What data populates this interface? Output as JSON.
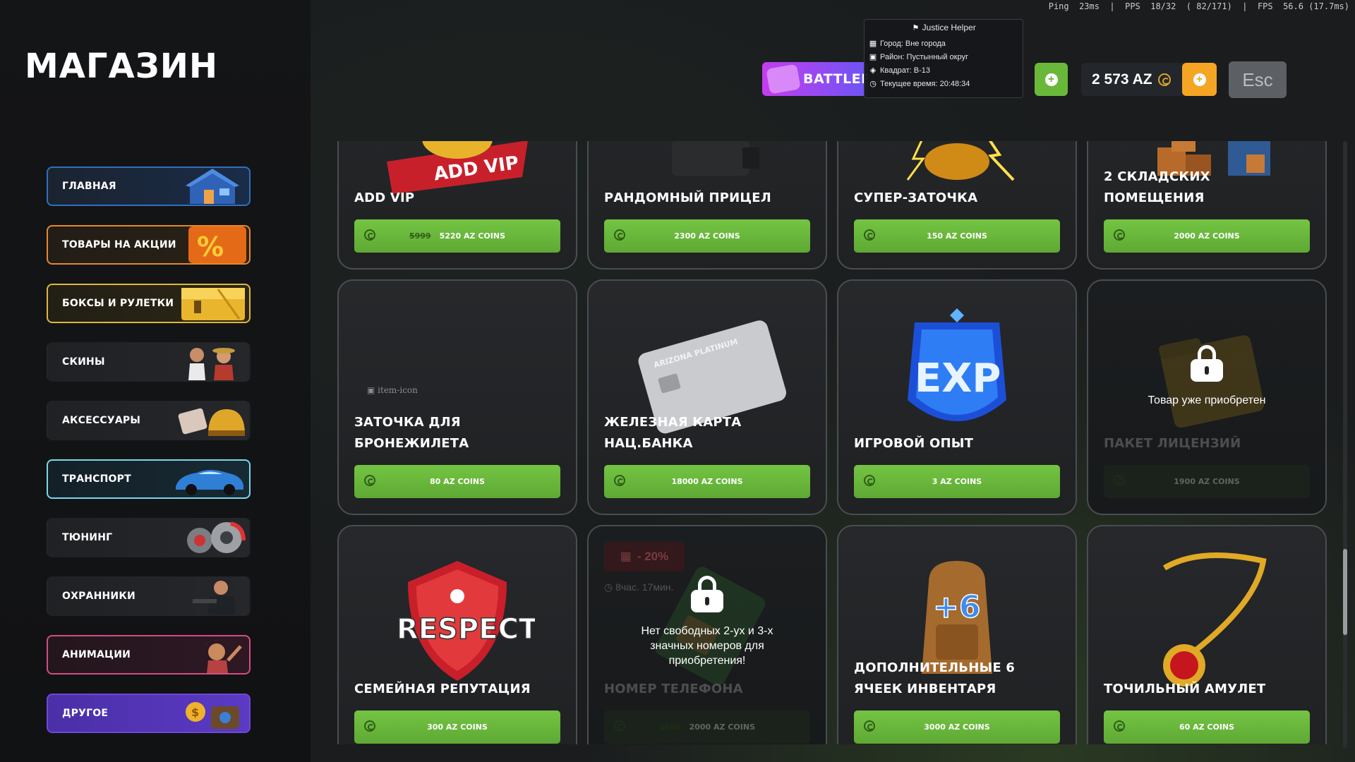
{
  "title": "МАГАЗИН",
  "perf": "Ping  23ms  |  PPS  18/32  ( 82/171)  |  FPS  56.6 (17.7ms)",
  "sidebar": {
    "items": [
      {
        "label": "ГЛАВНАЯ",
        "icon": "house-icon",
        "style": "blue"
      },
      {
        "label": "ТОВАРЫ НА АКЦИИ",
        "icon": "percent-icon",
        "style": "orange"
      },
      {
        "label": "БОКСЫ И РУЛЕТКИ",
        "icon": "chest-icon",
        "style": "yellow"
      },
      {
        "label": "СКИНЫ",
        "icon": "characters-icon",
        "style": ""
      },
      {
        "label": "АКСЕССУАРЫ",
        "icon": "helmet-icon",
        "style": ""
      },
      {
        "label": "ТРАНСПОРТ",
        "icon": "car-icon",
        "style": "cyan"
      },
      {
        "label": "ТЮНИНГ",
        "icon": "wheel-icon",
        "style": ""
      },
      {
        "label": "ОХРАННИКИ",
        "icon": "guard-icon",
        "style": ""
      },
      {
        "label": "АНИМАЦИИ",
        "icon": "dancer-icon",
        "style": "pink"
      },
      {
        "label": "ДРУГОЕ",
        "icon": "coins-bag-icon",
        "style": "purple"
      }
    ]
  },
  "topbar": {
    "battlepass": "BATTLEP",
    "balance": "2 573 AZ",
    "esc": "Esc"
  },
  "helper": {
    "title": "Justice Helper",
    "city": "Город: Вне города",
    "district": "Район: Пустынный округ",
    "square": "Квадрат: B-13",
    "time": "Текущее время: 20:48:34"
  },
  "products": [
    {
      "title": "ADD VIP",
      "price": "5220 AZ COINS",
      "old_price": "5999",
      "art": "vip-ribbon-icon"
    },
    {
      "title": "РАНДОМНЫЙ ПРИЦЕЛ",
      "price": "2300 AZ COINS",
      "art": "scope-icon"
    },
    {
      "title": "СУПЕР-ЗАТОЧКА",
      "price": "150 AZ COINS",
      "art": "lightning-icon"
    },
    {
      "title": "2 СКЛАДСКИХ ПОМЕЩЕНИЯ",
      "price": "2000 AZ COINS",
      "art": "warehouse-icon"
    },
    {
      "title": "ЗАТОЧКА ДЛЯ БРОНЕЖИЛЕТА",
      "price": "80 AZ COINS",
      "art": "broken-image-icon",
      "broken_alt": "item-icon"
    },
    {
      "title": "ЖЕЛЕЗНАЯ КАРТА НАЦ.БАНКА",
      "price": "18000 AZ COINS",
      "art": "bank-card-icon",
      "card_text": "ARIZONA PLATINUM"
    },
    {
      "title": "ИГРОВОЙ ОПЫТ",
      "price": "3 AZ COINS",
      "art": "exp-badge-icon",
      "badge_text": "EXP"
    },
    {
      "title": "ПАКЕТ ЛИЦЕНЗИЙ",
      "price": "1900 AZ COINS",
      "art": "license-folder-icon",
      "locked": true,
      "lock_text": "Товар уже приобретен"
    },
    {
      "title": "СЕМЕЙНАЯ РЕПУТАЦИЯ",
      "price": "300 AZ COINS",
      "art": "respect-shield-icon",
      "badge_text": "RESPECT"
    },
    {
      "title": "НОМЕР ТЕЛЕФОНА",
      "price": "2000 AZ COINS",
      "old_price": "2500",
      "art": "sim-card-icon",
      "locked": true,
      "lock_text": "Нет свободных 2-ух и 3-х значных номеров для приобретения!",
      "discount": "- 20%",
      "timer": "8час. 17мин."
    },
    {
      "title": "ДОПОЛНИТЕЛЬНЫЕ 6 ЯЧЕЕК ИНВЕНТАРЯ",
      "price": "3000 AZ COINS",
      "art": "backpack-icon",
      "badge_text": "+6"
    },
    {
      "title": "ТОЧИЛЬНЫЙ АМУЛЕТ",
      "price": "60 AZ COINS",
      "art": "amulet-icon"
    }
  ],
  "colors": {
    "buy_green": "#6ab83a",
    "accent_orange": "#f5a524",
    "battlepass_purple": "#8a4cf2"
  }
}
